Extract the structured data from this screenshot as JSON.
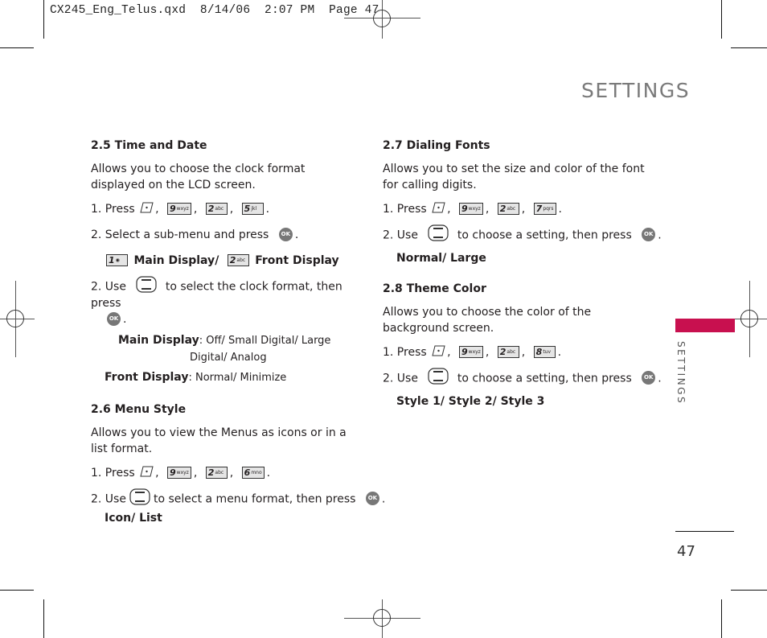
{
  "slug": "CX245_Eng_Telus.qxd  8/14/06  2:07 PM  Page 47",
  "page_title": "SETTINGS",
  "side_tab_label": "SETTINGS",
  "page_number": "47",
  "colors": {
    "accent": "#c8104f",
    "title_gray": "#7a7a7a"
  },
  "icons": {
    "menu_key": "menu-softkey-icon",
    "nav_key": "navigation-key-icon",
    "ok_key": "ok-key-icon",
    "ok_label": "OK"
  },
  "sections": [
    {
      "heading": "2.5 Time and Date",
      "description": "Allows you to choose the clock format displayed on the LCD screen.",
      "step1_prefix": "1. Press",
      "keys": [
        {
          "digit": "9",
          "letters": "wxyz"
        },
        {
          "digit": "2",
          "letters": "abc"
        },
        {
          "digit": "5",
          "letters": "jkl"
        }
      ],
      "step2": "2. Select a sub-menu and press",
      "submenu": [
        {
          "digit": "1",
          "letters": "",
          "label": "Main Display/"
        },
        {
          "digit": "2",
          "letters": "abc",
          "label": "Front Display"
        }
      ],
      "step3_prefix": "2. Use",
      "step3_suffix": "to select the clock format, then press",
      "options": [
        {
          "label": "Main Display",
          "value": ": Off/ Small Digital/ Large Digital/ Analog"
        },
        {
          "label": "Front Display",
          "value": ": Normal/ Minimize"
        }
      ]
    },
    {
      "heading": "2.6 Menu Style",
      "description": "Allows you to view the Menus as icons or in a list format.",
      "step1_prefix": "1. Press",
      "keys": [
        {
          "digit": "9",
          "letters": "wxyz"
        },
        {
          "digit": "2",
          "letters": "abc"
        },
        {
          "digit": "6",
          "letters": "mno"
        }
      ],
      "step2_prefix": "2. Use",
      "step2_suffix": "to select a menu format, then press",
      "options_text": "Icon/ List"
    },
    {
      "heading": "2.7 Dialing Fonts",
      "description": "Allows you to set the size and color of the font for calling digits.",
      "step1_prefix": "1. Press",
      "keys": [
        {
          "digit": "9",
          "letters": "wxyz"
        },
        {
          "digit": "2",
          "letters": "abc"
        },
        {
          "digit": "7",
          "letters": "pqrs"
        }
      ],
      "step2_prefix": "2. Use",
      "step2_suffix": "to choose a setting, then press",
      "options_text": "Normal/ Large"
    },
    {
      "heading": "2.8 Theme Color",
      "description": "Allows you to choose the color of the background screen.",
      "step1_prefix": "1. Press",
      "keys": [
        {
          "digit": "9",
          "letters": "wxyz"
        },
        {
          "digit": "2",
          "letters": "abc"
        },
        {
          "digit": "8",
          "letters": "tuv"
        }
      ],
      "step2_prefix": "2. Use",
      "step2_suffix": "to choose a setting, then press",
      "options_text": "Style 1/ Style 2/ Style 3"
    }
  ]
}
